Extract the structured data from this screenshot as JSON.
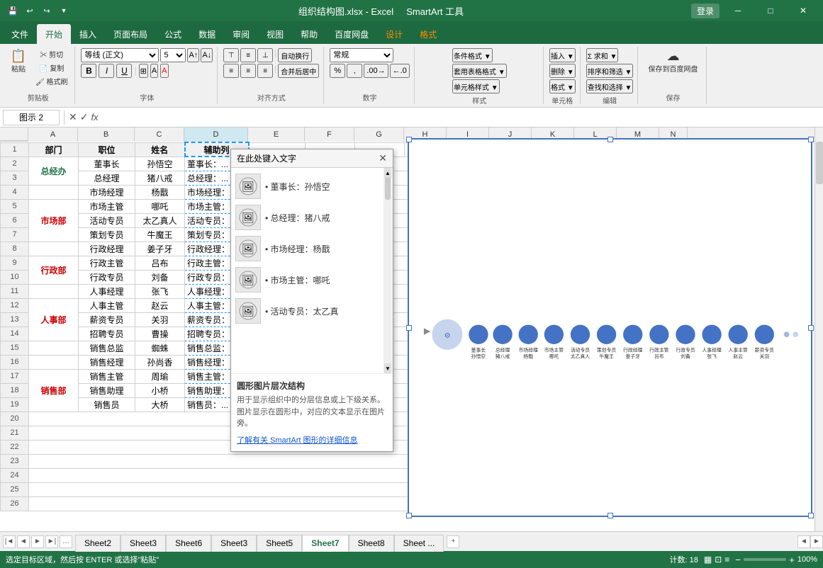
{
  "titlebar": {
    "filename": "组织结构图.xlsx - Excel",
    "smartart_tool": "SmartArt 工具",
    "login": "登录",
    "save_icon": "💾",
    "undo_icon": "↩",
    "redo_icon": "↪"
  },
  "ribbon_tabs": [
    {
      "label": "文件",
      "active": false
    },
    {
      "label": "开始",
      "active": true
    },
    {
      "label": "插入",
      "active": false
    },
    {
      "label": "页面布局",
      "active": false
    },
    {
      "label": "公式",
      "active": false
    },
    {
      "label": "数据",
      "active": false
    },
    {
      "label": "审阅",
      "active": false
    },
    {
      "label": "视图",
      "active": false
    },
    {
      "label": "帮助",
      "active": false
    },
    {
      "label": "百度网盘",
      "active": false
    },
    {
      "label": "设计",
      "active": false
    },
    {
      "label": "格式",
      "active": false
    }
  ],
  "smartart_tabs": [
    {
      "label": "设计",
      "active": false
    },
    {
      "label": "格式",
      "active": false
    }
  ],
  "name_box": "图示 2",
  "formula_bar": "fx",
  "columns": [
    "A",
    "B",
    "C",
    "D",
    "E",
    "F",
    "G",
    "H",
    "I",
    "J",
    "K",
    "L",
    "M",
    "N"
  ],
  "rows": [
    {
      "num": 1,
      "cells": [
        "部门",
        "职位",
        "姓名",
        "辅助列",
        "",
        "",
        "",
        "",
        "",
        "",
        "",
        "",
        "",
        ""
      ]
    },
    {
      "num": 2,
      "cells": [
        "总经办",
        "董事长",
        "孙悟空",
        "董事长：...",
        "",
        "",
        "",
        "",
        "",
        "",
        "",
        "",
        "",
        ""
      ]
    },
    {
      "num": 3,
      "cells": [
        "",
        "总经理",
        "猪八戒",
        "总经理：...",
        "",
        "",
        "",
        "",
        "",
        "",
        "",
        "",
        "",
        ""
      ]
    },
    {
      "num": 4,
      "cells": [
        "",
        "市场经理",
        "杨戬",
        "市场经理：...",
        "",
        "",
        "",
        "",
        "",
        "",
        "",
        "",
        "",
        ""
      ]
    },
    {
      "num": 5,
      "cells": [
        "市场部",
        "市场主管",
        "哪吒",
        "市场主管：...",
        "",
        "",
        "",
        "",
        "",
        "",
        "",
        "",
        "",
        ""
      ]
    },
    {
      "num": 6,
      "cells": [
        "",
        "活动专员",
        "太乙真人",
        "活动专员：...",
        "",
        "",
        "",
        "",
        "",
        "",
        "",
        "",
        "",
        ""
      ]
    },
    {
      "num": 7,
      "cells": [
        "",
        "策划专员",
        "牛魔王",
        "策划专员：...",
        "",
        "",
        "",
        "",
        "",
        "",
        "",
        "",
        "",
        ""
      ]
    },
    {
      "num": 8,
      "cells": [
        "",
        "行政经理",
        "姜子牙",
        "行政经理：...",
        "",
        "",
        "",
        "",
        "",
        "",
        "",
        "",
        "",
        ""
      ]
    },
    {
      "num": 9,
      "cells": [
        "行政部",
        "行政主管",
        "吕布",
        "行政主管：...",
        "",
        "",
        "",
        "",
        "",
        "",
        "",
        "",
        "",
        ""
      ]
    },
    {
      "num": 10,
      "cells": [
        "",
        "行政专员",
        "刘备",
        "行政专员：...",
        "",
        "",
        "",
        "",
        "",
        "",
        "",
        "",
        "",
        ""
      ]
    },
    {
      "num": 11,
      "cells": [
        "",
        "人事经理",
        "张飞",
        "人事经理：...",
        "",
        "",
        "",
        "",
        "",
        "",
        "",
        "",
        "",
        ""
      ]
    },
    {
      "num": 12,
      "cells": [
        "人事部",
        "人事主管",
        "赵云",
        "人事主管：...",
        "",
        "",
        "",
        "",
        "",
        "",
        "",
        "",
        "",
        ""
      ]
    },
    {
      "num": 13,
      "cells": [
        "",
        "薪资专员",
        "关羽",
        "薪资专员：...",
        "",
        "",
        "",
        "",
        "",
        "",
        "",
        "",
        "",
        ""
      ]
    },
    {
      "num": 14,
      "cells": [
        "",
        "招聘专员",
        "曹操",
        "招聘专员：...",
        "",
        "",
        "",
        "",
        "",
        "",
        "",
        "",
        "",
        ""
      ]
    },
    {
      "num": 15,
      "cells": [
        "",
        "销售总监",
        "蜘蛛",
        "销售总监：...",
        "",
        "",
        "",
        "",
        "",
        "",
        "",
        "",
        "",
        ""
      ]
    },
    {
      "num": 16,
      "cells": [
        "",
        "销售经理",
        "孙尚香",
        "销售经理：...",
        "",
        "",
        "",
        "",
        "",
        "",
        "",
        "",
        "",
        ""
      ]
    },
    {
      "num": 17,
      "cells": [
        "销售部",
        "销售主管",
        "周瑜",
        "销售主管：...",
        "",
        "",
        "",
        "",
        "",
        "",
        "",
        "",
        "",
        ""
      ]
    },
    {
      "num": 18,
      "cells": [
        "",
        "销售助理",
        "小桥",
        "销售助理：...",
        "",
        "",
        "",
        "",
        "",
        "",
        "",
        "",
        "",
        ""
      ]
    },
    {
      "num": 19,
      "cells": [
        "",
        "销售员",
        "大桥",
        "销售员：...",
        "",
        "",
        "",
        "",
        "",
        "",
        "",
        "",
        "",
        ""
      ]
    },
    {
      "num": 20,
      "cells": [
        "",
        "",
        "",
        "",
        "",
        "",
        "",
        "",
        "",
        "",
        "",
        "",
        "",
        ""
      ]
    },
    {
      "num": 21,
      "cells": [
        "",
        "",
        "",
        "",
        "",
        "",
        "",
        "",
        "",
        "",
        "",
        "",
        "",
        ""
      ]
    },
    {
      "num": 22,
      "cells": [
        "",
        "",
        "",
        "",
        "",
        "",
        "",
        "",
        "",
        "",
        "",
        "",
        "",
        ""
      ]
    },
    {
      "num": 23,
      "cells": [
        "",
        "",
        "",
        "",
        "",
        "",
        "",
        "",
        "",
        "",
        "",
        "",
        "",
        ""
      ]
    },
    {
      "num": 24,
      "cells": [
        "",
        "",
        "",
        "",
        "",
        "",
        "",
        "",
        "",
        "",
        "",
        "",
        "",
        ""
      ]
    },
    {
      "num": 25,
      "cells": [
        "",
        "",
        "",
        "",
        "",
        "",
        "",
        "",
        "",
        "",
        "",
        "",
        "",
        ""
      ]
    },
    {
      "num": 26,
      "cells": [
        "",
        "",
        "",
        "",
        "",
        "",
        "",
        "",
        "",
        "",
        "",
        "",
        "",
        ""
      ]
    }
  ],
  "dialog": {
    "title": "在此处键入文字",
    "close_icon": "✕",
    "items": [
      {
        "text": "• 董事长：孙悟空"
      },
      {
        "text": "• 总经理：猪八戒"
      },
      {
        "text": "• 市场经理：杨戬"
      },
      {
        "text": "• 市场主管：哪吒"
      },
      {
        "text": "• 活动专员：太乙真"
      },
      {
        "text": "• ..."
      }
    ],
    "footer_title": "圆形图片层次结构",
    "footer_desc": "用于显示组织中的分层信息或上下级关系。图片显示在圆形中，对应的文本显示在图片旁。",
    "footer_link": "了解有关 SmartArt 图形的详细信息"
  },
  "sheet_tabs": [
    {
      "label": "Sheet2"
    },
    {
      "label": "Sheet3"
    },
    {
      "label": "Sheet6"
    },
    {
      "label": "Sheet3"
    },
    {
      "label": "Sheet5"
    },
    {
      "label": "Sheet7",
      "active": true
    },
    {
      "label": "Sheet8"
    },
    {
      "label": "Sheet ...",
      "ellipsis": true
    }
  ],
  "status_bar": {
    "left": "选定目标区域，然后按 ENTER 或选择\"粘贴\"",
    "count": "计数: 18",
    "zoom": "100%"
  },
  "dept_colors": {
    "总经办": "#217346",
    "市场部": "#FF0000",
    "行政部": "#FF0000",
    "人事部": "#FF0000",
    "销售部": "#FF0000"
  }
}
